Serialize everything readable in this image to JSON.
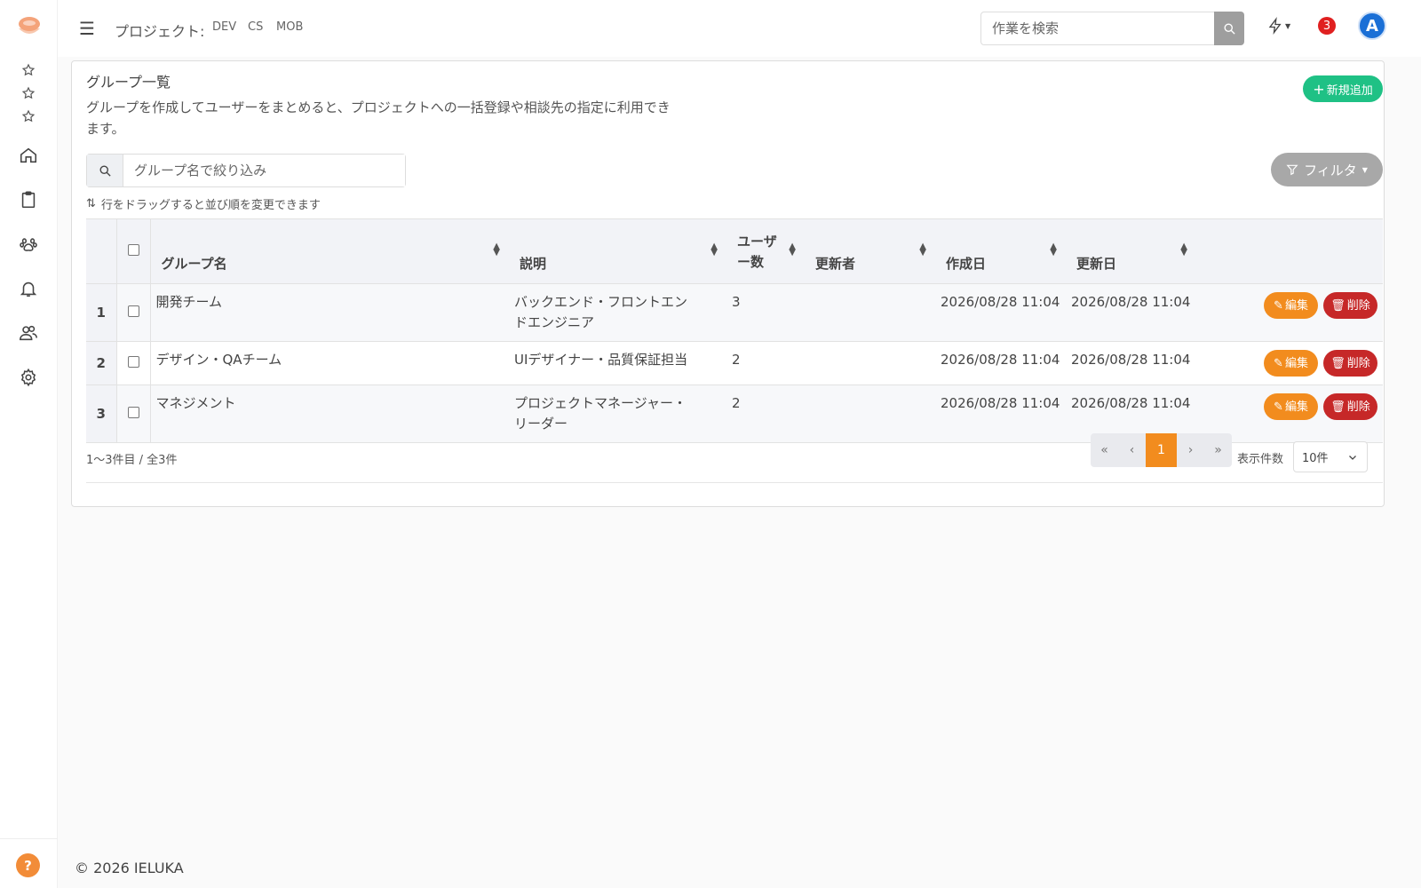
{
  "header": {
    "project_label": "プロジェクト:",
    "projects": [
      "DEV",
      "CS",
      "MOB"
    ],
    "search_placeholder": "作業を検索",
    "notification_count": "3",
    "avatar_initial": "A"
  },
  "card": {
    "title": "グループ一覧",
    "description": "グループを作成してユーザーをまとめると、プロジェクトへの一括登録や相談先の指定に利用できます。",
    "add_button": "新規追加",
    "filter_placeholder": "グループ名で絞り込み",
    "filter_button": "フィルタ",
    "drag_hint": "行をドラッグすると並び順を変更できます"
  },
  "table": {
    "columns": [
      "グループ名",
      "説明",
      "ユーザー数",
      "更新者",
      "作成日",
      "更新日"
    ],
    "edit_label": "編集",
    "delete_label": "削除",
    "rows": [
      {
        "no": "1",
        "name": "開発チーム",
        "description": "バックエンド・フロントエンドエンジニア",
        "users": "3",
        "updater": "",
        "created": "2026/08/28 11:04",
        "updated": "2026/08/28 11:04"
      },
      {
        "no": "2",
        "name": "デザイン・QAチーム",
        "description": "UIデザイナー・品質保証担当",
        "users": "2",
        "updater": "",
        "created": "2026/08/28 11:04",
        "updated": "2026/08/28 11:04"
      },
      {
        "no": "3",
        "name": "マネジメント",
        "description": "プロジェクトマネージャー・リーダー",
        "users": "2",
        "updater": "",
        "created": "2026/08/28 11:04",
        "updated": "2026/08/28 11:04"
      }
    ]
  },
  "pagination": {
    "range_info": "1〜3件目 / 全3件",
    "first": "«",
    "prev": "‹",
    "current": "1",
    "next": "›",
    "last": "»",
    "per_page_label": "表示件数",
    "per_page_value": "10件"
  },
  "footer": {
    "copyright": "© 2026 IELUKA",
    "help": "?"
  },
  "colors": {
    "accent_orange": "#f28c1e",
    "add_green": "#1fc185",
    "delete_red": "#c62828",
    "avatar_blue": "#1a6fd6"
  }
}
